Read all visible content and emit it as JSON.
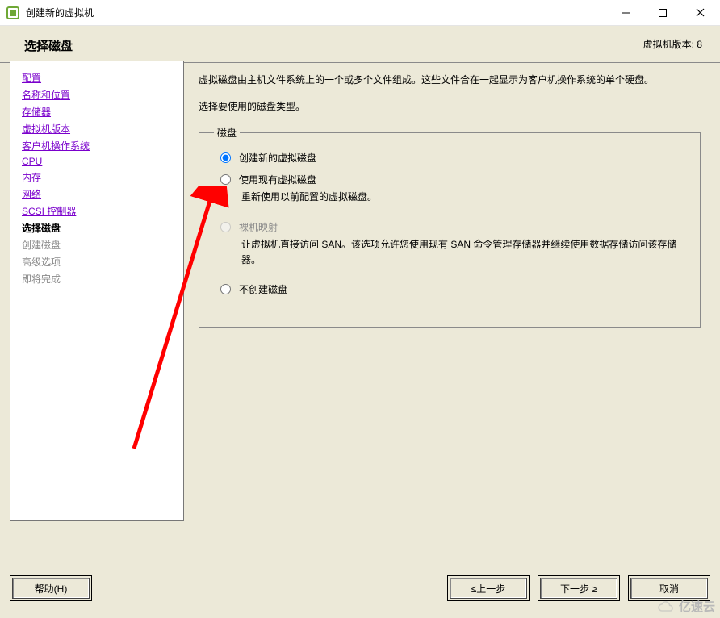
{
  "window": {
    "title": "创建新的虚拟机",
    "controls": {
      "min": "minimize",
      "max": "maximize",
      "close": "close"
    }
  },
  "header": {
    "page_title": "选择磁盘",
    "version_label": "虚拟机版本: 8"
  },
  "sidebar": {
    "steps": [
      {
        "label": "配置",
        "state": "link"
      },
      {
        "label": "名称和位置",
        "state": "link"
      },
      {
        "label": "存储器",
        "state": "link"
      },
      {
        "label": "虚拟机版本",
        "state": "link"
      },
      {
        "label": "客户机操作系统",
        "state": "link"
      },
      {
        "label": "CPU",
        "state": "link"
      },
      {
        "label": "内存",
        "state": "link"
      },
      {
        "label": "网络",
        "state": "link"
      },
      {
        "label": "SCSI 控制器",
        "state": "link"
      },
      {
        "label": "选择磁盘",
        "state": "current"
      },
      {
        "label": "创建磁盘",
        "state": "future"
      },
      {
        "label": "高级选项",
        "state": "future"
      },
      {
        "label": "即将完成",
        "state": "future"
      }
    ]
  },
  "content": {
    "description": "虚拟磁盘由主机文件系统上的一个或多个文件组成。这些文件合在一起显示为客户机操作系统的单个硬盘。",
    "prompt": "选择要使用的磁盘类型。",
    "fieldset_legend": "磁盘",
    "options": [
      {
        "id": "create-new",
        "label": "创建新的虚拟磁盘",
        "desc": "",
        "enabled": true,
        "selected": true
      },
      {
        "id": "use-existing",
        "label": "使用现有虚拟磁盘",
        "desc": "重新使用以前配置的虚拟磁盘。",
        "enabled": true,
        "selected": false
      },
      {
        "id": "raw-mapping",
        "label": "裸机映射",
        "desc": "让虚拟机直接访问 SAN。该选项允许您使用现有 SAN 命令管理存储器并继续使用数据存储访问该存储器。",
        "enabled": false,
        "selected": false
      },
      {
        "id": "no-disk",
        "label": "不创建磁盘",
        "desc": "",
        "enabled": true,
        "selected": false
      }
    ]
  },
  "footer": {
    "help": "帮助(H)",
    "back": "≤上一步",
    "next": "下一步 ≥",
    "cancel": "取消"
  },
  "watermark": {
    "text": "亿速云"
  },
  "annotation": {
    "arrow_color": "#ff0000"
  }
}
